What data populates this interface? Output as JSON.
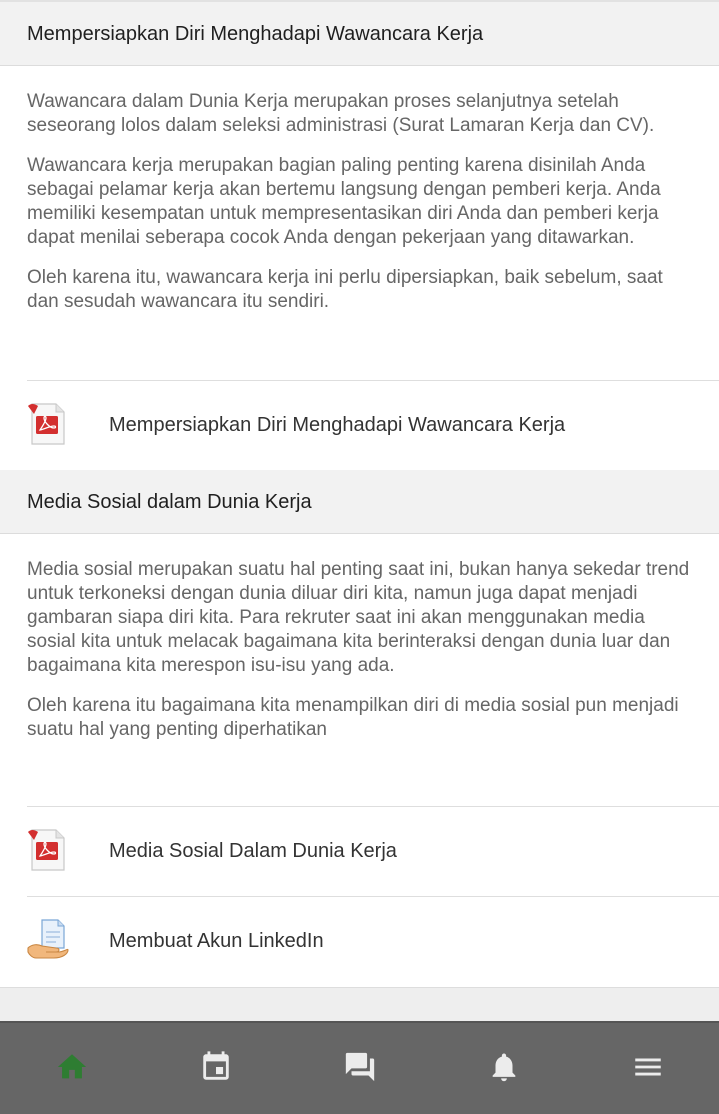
{
  "sections": [
    {
      "title": "Mempersiapkan Diri Menghadapi Wawancara Kerja",
      "paragraphs": [
        "Wawancara dalam Dunia Kerja merupakan proses selanjutnya setelah seseorang lolos dalam seleksi administrasi (Surat Lamaran Kerja dan CV).",
        "Wawancara kerja merupakan bagian paling penting karena disinilah Anda sebagai pelamar kerja akan bertemu langsung dengan pemberi kerja. Anda memiliki kesempatan untuk mempresentasikan diri Anda dan pemberi kerja dapat menilai seberapa cocok Anda dengan pekerjaan yang ditawarkan.",
        "Oleh karena itu, wawancara kerja ini perlu dipersiapkan, baik sebelum, saat dan sesudah wawancara itu sendiri."
      ],
      "activities": [
        {
          "label": "Mempersiapkan Diri Menghadapi Wawancara Kerja",
          "icon": "pdf-icon"
        }
      ]
    },
    {
      "title": "Media Sosial dalam Dunia Kerja",
      "paragraphs": [
        "Media sosial merupakan suatu hal penting saat ini, bukan hanya sekedar trend untuk terkoneksi dengan dunia diluar diri kita, namun juga dapat menjadi gambaran siapa diri kita.  Para rekruter saat ini akan menggunakan media sosial kita untuk melacak bagaimana kita berinteraksi dengan dunia luar dan bagaimana kita merespon isu-isu yang ada.",
        "Oleh karena itu bagaimana kita menampilkan diri di media sosial pun menjadi suatu hal yang penting diperhatikan"
      ],
      "activities": [
        {
          "label": "Media Sosial Dalam Dunia Kerja",
          "icon": "pdf-icon"
        },
        {
          "label": "Membuat Akun LinkedIn",
          "icon": "assignment-hand-icon"
        }
      ]
    }
  ],
  "bottom_nav": {
    "items": [
      {
        "name": "home",
        "icon": "home-icon",
        "active": true
      },
      {
        "name": "calendar",
        "icon": "calendar-icon",
        "active": false
      },
      {
        "name": "messages",
        "icon": "messages-icon",
        "active": false
      },
      {
        "name": "notifications",
        "icon": "bell-icon",
        "active": false
      },
      {
        "name": "menu",
        "icon": "menu-icon",
        "active": false
      }
    ]
  },
  "colors": {
    "active_nav": "#2e7d32",
    "inactive_nav": "#ececec",
    "nav_background": "#666666",
    "section_header_bg": "#f2f2f2",
    "summary_text": "#666666"
  }
}
